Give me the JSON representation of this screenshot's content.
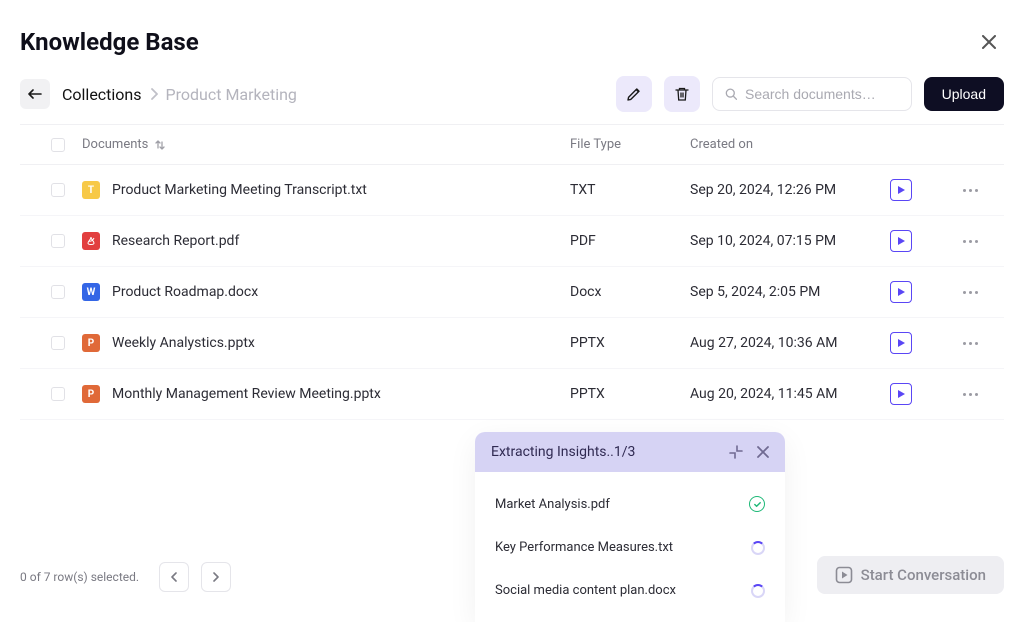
{
  "header": {
    "title": "Knowledge Base"
  },
  "breadcrumb": {
    "root": "Collections",
    "current": "Product Marketing"
  },
  "toolbar": {
    "search_placeholder": "Search documents…",
    "upload_label": "Upload"
  },
  "table": {
    "columns": {
      "documents": "Documents",
      "file_type": "File Type",
      "created_on": "Created on"
    },
    "rows": [
      {
        "name": "Product Marketing Meeting Transcript.txt",
        "type": "TXT",
        "created": "Sep 20, 2024, 12:26 PM",
        "icon_letter": "T",
        "icon_class": "fi-txt"
      },
      {
        "name": "Research Report.pdf",
        "type": "PDF",
        "created": "Sep 10, 2024, 07:15 PM",
        "icon_letter": "",
        "icon_class": "fi-pdf"
      },
      {
        "name": "Product Roadmap.docx",
        "type": "Docx",
        "created": "Sep 5, 2024, 2:05 PM",
        "icon_letter": "W",
        "icon_class": "fi-docx"
      },
      {
        "name": "Weekly Analystics.pptx",
        "type": "PPTX",
        "created": "Aug 27, 2024, 10:36 AM",
        "icon_letter": "P",
        "icon_class": "fi-pptx"
      },
      {
        "name": "Monthly Management Review Meeting.pptx",
        "type": "PPTX",
        "created": "Aug 20, 2024, 11:45 AM",
        "icon_letter": "P",
        "icon_class": "fi-pptx"
      }
    ]
  },
  "footer": {
    "selection_text": "0 of 7 row(s) selected."
  },
  "start_conversation": {
    "label": "Start Conversation"
  },
  "toast": {
    "title": "Extracting Insights..1/3",
    "items": [
      {
        "name": "Market Analysis.pdf",
        "status": "done"
      },
      {
        "name": "Key Performance Measures.txt",
        "status": "loading"
      },
      {
        "name": "Social media content plan.docx",
        "status": "loading"
      }
    ]
  }
}
